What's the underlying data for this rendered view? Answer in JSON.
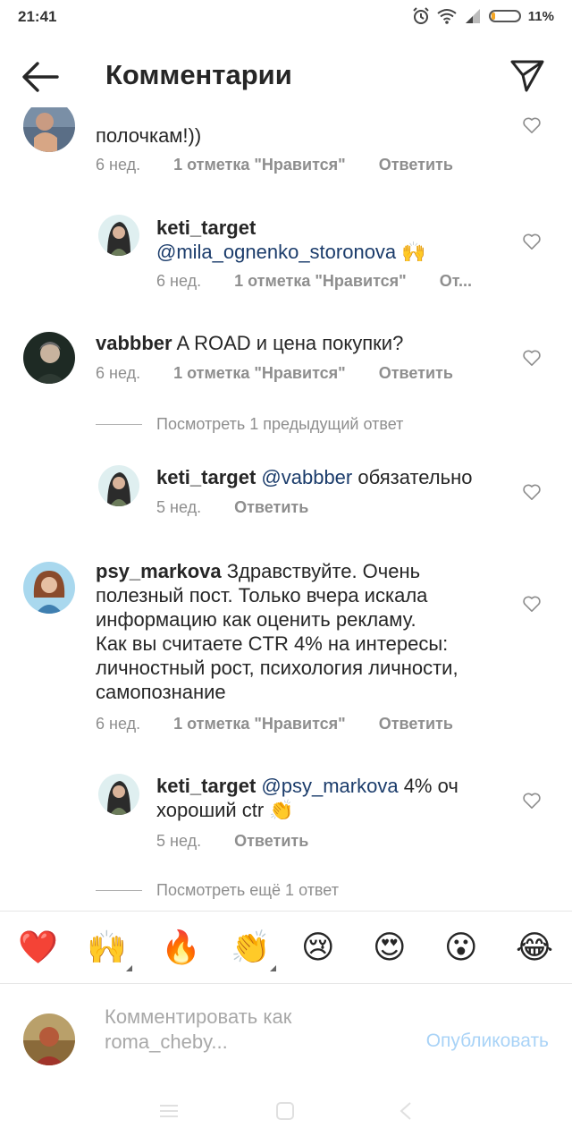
{
  "status": {
    "time": "21:41",
    "battery": "11%"
  },
  "header": {
    "title": "Комментарии"
  },
  "comments": [
    {
      "text": "полочкам!))",
      "time": "6 нед.",
      "likes": "1 отметка \"Нравится\"",
      "reply": "Ответить"
    },
    {
      "user": "keti_target",
      "mention": "@mila_ognenko_storonova",
      "text": " 🙌",
      "time": "6 нед.",
      "likes": "1 отметка \"Нравится\"",
      "reply": "От..."
    },
    {
      "user": "vabbber",
      "text": " A ROAD и цена покупки?",
      "time": "6 нед.",
      "likes": "1 отметка \"Нравится\"",
      "reply": "Ответить"
    },
    {
      "view_more": "Посмотреть 1 предыдущий ответ"
    },
    {
      "user": "keti_target",
      "mention": "@vabbber",
      "text": " обязательно",
      "time": "5 нед.",
      "reply": "Ответить"
    },
    {
      "user": "psy_markova",
      "text_lines": [
        " Здравствуйте. Очень",
        "полезный пост. Только вчера искала",
        "информацию как оценить рекламу.",
        "Как вы считаете CTR 4% на интересы:",
        "личностный рост, психология личности,",
        "самопознание"
      ],
      "time": "6 нед.",
      "likes": "1 отметка \"Нравится\"",
      "reply": "Ответить"
    },
    {
      "user": "keti_target",
      "mention": "@psy_markova",
      "text": " 4% оч",
      "text2": "хороший ctr 👏",
      "time": "5 нед.",
      "reply": "Ответить"
    },
    {
      "view_more": "Посмотреть ещё 1 ответ"
    }
  ],
  "emojis": [
    "❤️",
    "🙌",
    "🔥",
    "👏",
    "😢",
    "😍",
    "😮",
    "😂"
  ],
  "compose": {
    "placeholder_line1": "Комментировать как",
    "placeholder_line2": "roma_cheby...",
    "publish": "Опубликовать"
  },
  "colors": {
    "mention": "#1b3c6b",
    "meta": "#8e8e8e",
    "publish": "#a9d3f7"
  }
}
